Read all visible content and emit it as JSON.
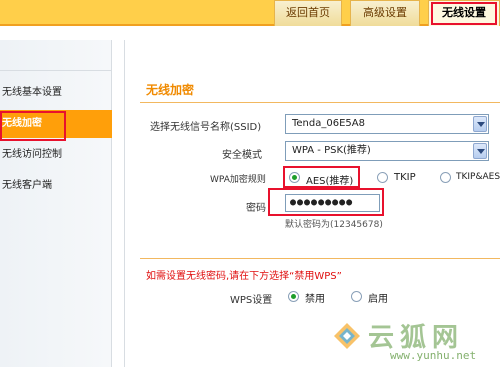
{
  "header": {
    "tabs": [
      {
        "label": "返回首页"
      },
      {
        "label": "高级设置"
      },
      {
        "label": "无线设置"
      }
    ]
  },
  "sidebar": {
    "items": [
      {
        "label": "无线基本设置"
      },
      {
        "label": "无线加密"
      },
      {
        "label": "无线访问控制"
      },
      {
        "label": "无线客户端"
      }
    ]
  },
  "main": {
    "section_title": "无线加密",
    "ssid": {
      "label": "选择无线信号名称(SSID)",
      "value": "Tenda_06E5A8"
    },
    "security_mode": {
      "label": "安全模式",
      "value": "WPA - PSK(推荐)"
    },
    "wpa_rule": {
      "label": "WPA加密规则",
      "options": [
        {
          "label": "AES(推荐)",
          "selected": true
        },
        {
          "label": "TKIP",
          "selected": false
        },
        {
          "label": "TKIP&AES",
          "selected": false
        }
      ]
    },
    "password": {
      "label": "密码",
      "value": "●●●●●●●●●",
      "hint": "默认密码为(12345678)"
    },
    "notice": "如需设置无线密码,请在下方选择“禁用WPS”",
    "wps": {
      "label": "WPS设置",
      "options": [
        {
          "label": "禁用",
          "selected": true
        },
        {
          "label": "启用",
          "selected": false
        }
      ]
    }
  },
  "watermark": {
    "text": "云狐网",
    "url": "www.yunhu.net"
  },
  "colors": {
    "accent": "#ff9f0a",
    "highlight_box": "#e8112d",
    "topbar": "#ffcf4a"
  }
}
